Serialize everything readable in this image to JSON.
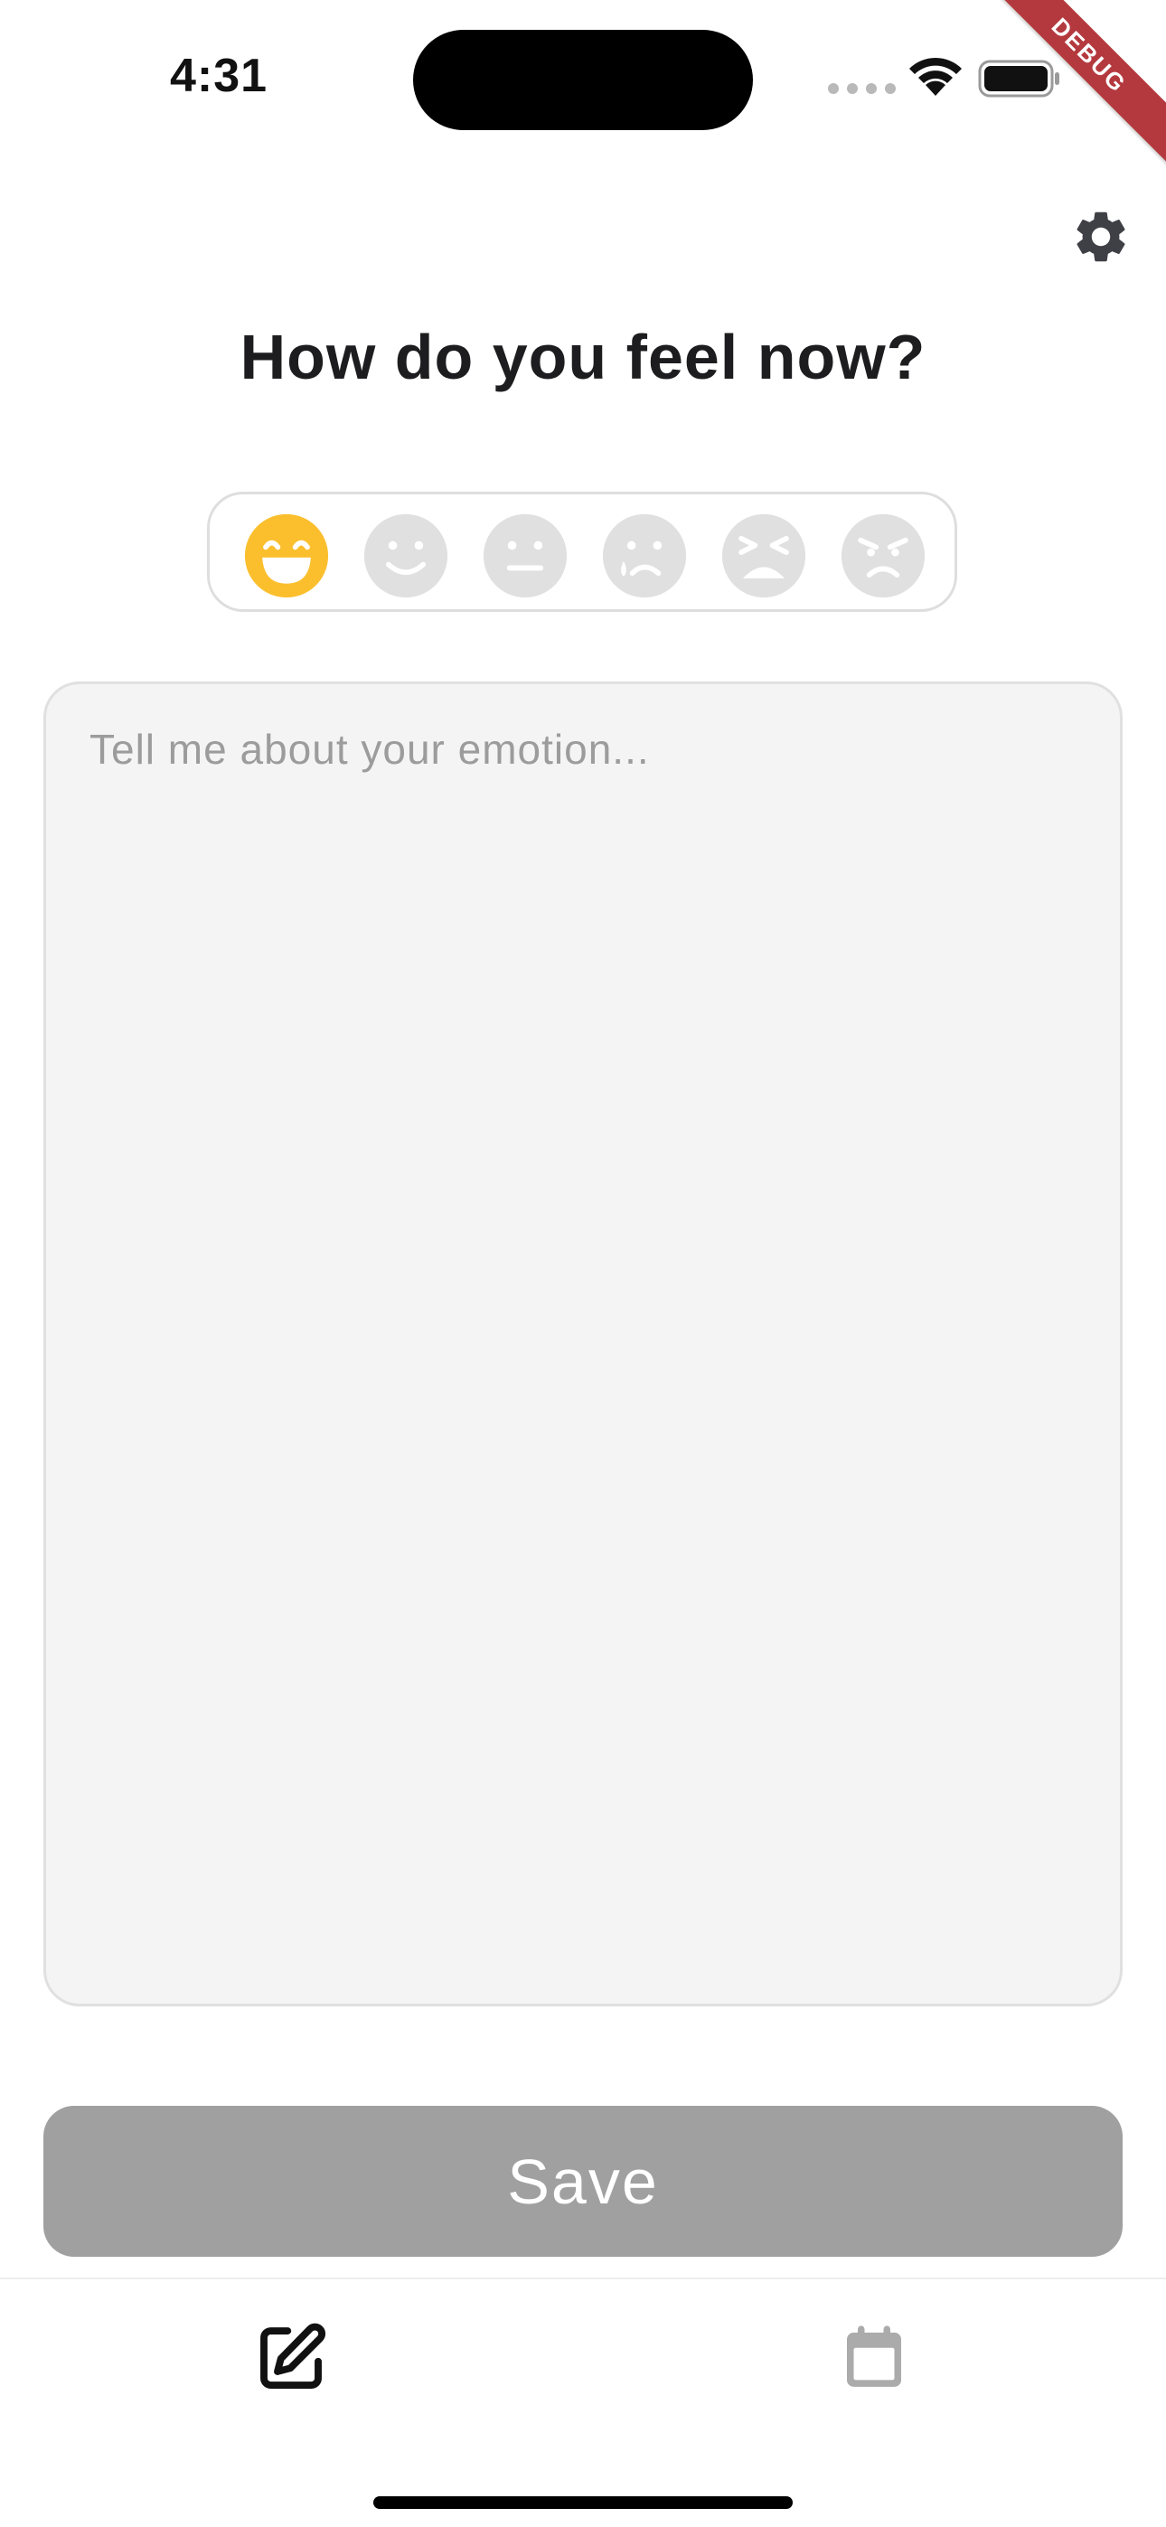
{
  "status_bar": {
    "time": "4:31",
    "debug_label": "DEBUG"
  },
  "header": {
    "title": "How do you feel now?"
  },
  "mood_picker": {
    "selected": "laughing",
    "accent_color": "#FBBF2E",
    "inactive_color": "#E0E0E0",
    "options": [
      {
        "name": "laughing",
        "icon": "grinning-face-icon"
      },
      {
        "name": "smiling",
        "icon": "smiling-face-icon"
      },
      {
        "name": "neutral",
        "icon": "neutral-face-icon"
      },
      {
        "name": "crying",
        "icon": "crying-face-icon"
      },
      {
        "name": "tired",
        "icon": "tired-face-icon"
      },
      {
        "name": "angry",
        "icon": "angry-face-icon"
      }
    ]
  },
  "emotion_input": {
    "value": "",
    "placeholder": "Tell me about your emotion..."
  },
  "save": {
    "label": "Save",
    "color": "#A0A0A0"
  },
  "bottom_nav": {
    "items": [
      {
        "icon": "edit-icon",
        "active": true
      },
      {
        "icon": "calendar-icon",
        "active": false
      }
    ]
  }
}
